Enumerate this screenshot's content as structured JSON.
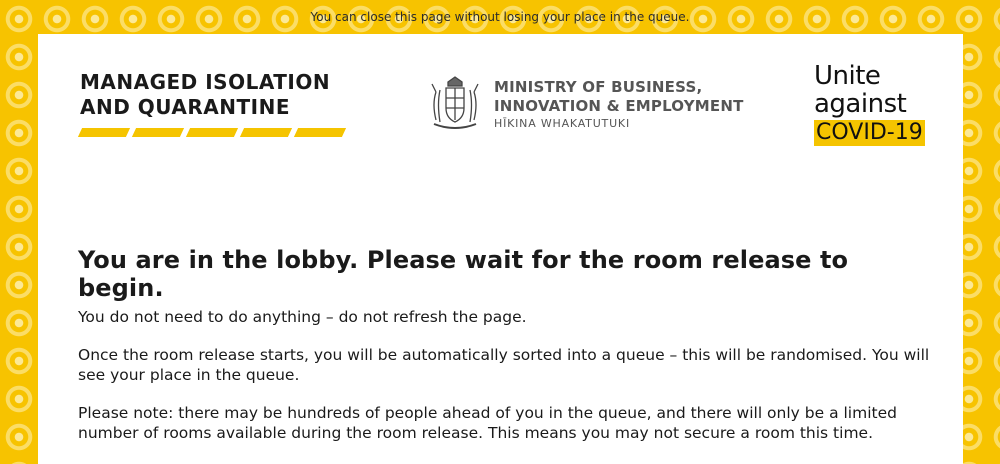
{
  "topbar": {
    "notice": "You can close this page without losing your place in the queue."
  },
  "logos": {
    "miq": {
      "line1": "MANAGED ISOLATION",
      "line2": "AND QUARANTINE"
    },
    "mbie": {
      "line1": "MINISTRY OF BUSINESS,",
      "line2": "INNOVATION & EMPLOYMENT",
      "sub": "HĪKINA WHAKATUTUKI"
    },
    "unite": {
      "line1": "Unite",
      "line2": "against",
      "badge": "COVID-19"
    }
  },
  "content": {
    "heading": "You are in the lobby. Please wait for the room release to begin.",
    "p1": "You do not need to do anything – do not refresh the page.",
    "p2": "Once the room release starts, you will be automatically sorted into a queue – this will be randomised. You will see your place in the queue.",
    "p3": "Please note: there may be hundreds of people ahead of you in the queue, and there will only be a limited number of rooms available during the room release. This means you may not secure a room this time."
  },
  "colors": {
    "brand_yellow": "#f7c300",
    "text": "#1a1a1a",
    "mbie_grey": "#555555"
  },
  "icons": {
    "crest": "nz-coat-of-arms-icon"
  }
}
